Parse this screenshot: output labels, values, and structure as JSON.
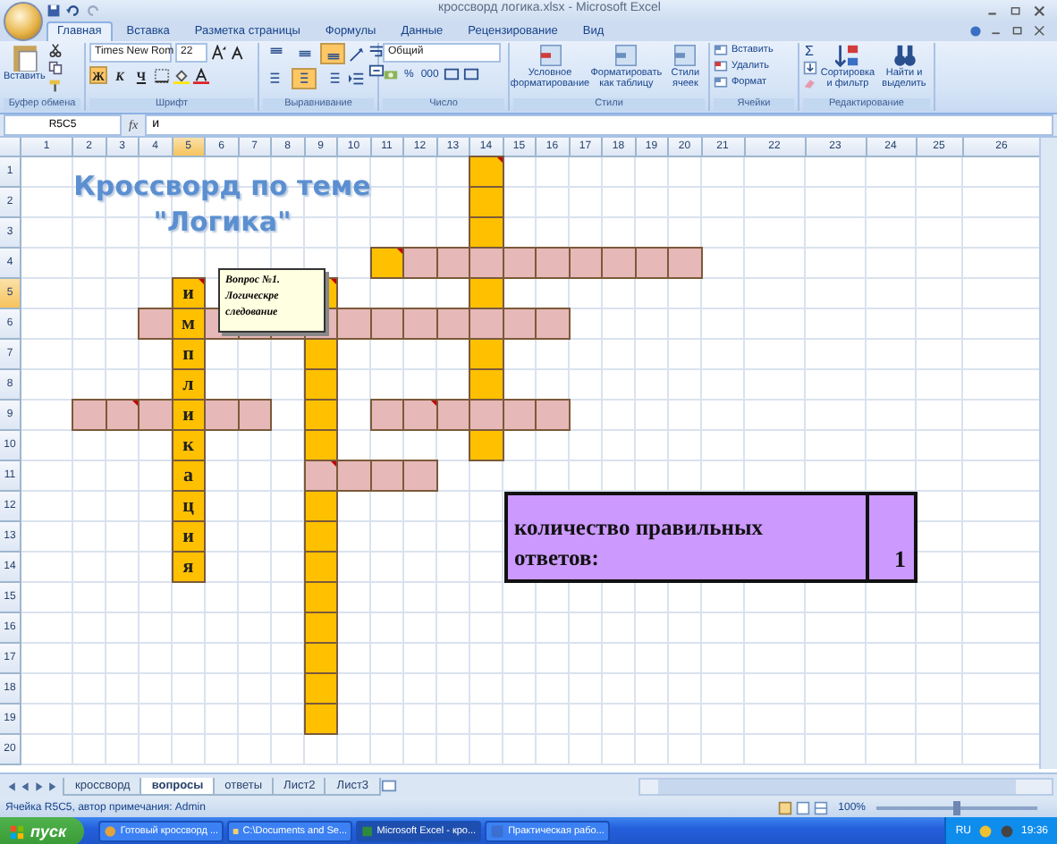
{
  "window": {
    "title": "кроссворд логика.xlsx - Microsoft Excel"
  },
  "ribbon_tabs": [
    {
      "label": "Главная",
      "selected": true
    },
    {
      "label": "Вставка",
      "selected": false
    },
    {
      "label": "Разметка страницы",
      "selected": false
    },
    {
      "label": "Формулы",
      "selected": false
    },
    {
      "label": "Данные",
      "selected": false
    },
    {
      "label": "Рецензирование",
      "selected": false
    },
    {
      "label": "Вид",
      "selected": false
    }
  ],
  "ribbon": {
    "clipboard": {
      "title": "Буфер обмена",
      "paste": "Вставить"
    },
    "font": {
      "title": "Шрифт",
      "font_name": "Times New Rom",
      "font_size": "22",
      "format_buttons": [
        {
          "label": "Ж",
          "on": true
        },
        {
          "label": "К",
          "on": false
        },
        {
          "label": "Ч",
          "on": false
        }
      ]
    },
    "alignment": {
      "title": "Выравнивание",
      "vertical": [
        {
          "on": false
        },
        {
          "on": false
        },
        {
          "on": true
        }
      ],
      "horizontal": [
        {
          "on": false
        },
        {
          "on": true
        },
        {
          "on": false
        }
      ]
    },
    "number": {
      "title": "Число",
      "format": "Общий",
      "symbols": [
        "%",
        "000"
      ]
    },
    "styles": {
      "title": "Стили",
      "buttons": [
        "Условное форматирование",
        "Форматировать как таблицу",
        "Стили ячеек"
      ]
    },
    "cells": {
      "title": "Ячейки",
      "buttons": [
        "Вставить",
        "Удалить",
        "Формат"
      ]
    },
    "editing": {
      "title": "Редактирование",
      "sum": "Σ",
      "buttons": [
        "Сортировка и фильтр",
        "Найти и выделить"
      ]
    }
  },
  "formula_bar": {
    "name_box": "R5C5",
    "function_label": "fx",
    "value": "и"
  },
  "columns": [
    {
      "label": "1",
      "selected": false
    },
    {
      "label": "2",
      "selected": false
    },
    {
      "label": "3",
      "selected": false
    },
    {
      "label": "4",
      "selected": false
    },
    {
      "label": "5",
      "selected": true
    },
    {
      "label": "6",
      "selected": false
    },
    {
      "label": "7",
      "selected": false
    },
    {
      "label": "8",
      "selected": false
    },
    {
      "label": "9",
      "selected": false
    },
    {
      "label": "10",
      "selected": false
    },
    {
      "label": "11",
      "selected": false
    },
    {
      "label": "12",
      "selected": false
    },
    {
      "label": "13",
      "selected": false
    },
    {
      "label": "14",
      "selected": false
    },
    {
      "label": "15",
      "selected": false
    },
    {
      "label": "16",
      "selected": false
    },
    {
      "label": "17",
      "selected": false
    },
    {
      "label": "18",
      "selected": false
    },
    {
      "label": "19",
      "selected": false
    },
    {
      "label": "20",
      "selected": false
    },
    {
      "label": "21",
      "selected": false
    },
    {
      "label": "22",
      "selected": false
    },
    {
      "label": "23",
      "selected": false
    },
    {
      "label": "24",
      "selected": false
    },
    {
      "label": "25",
      "selected": false
    },
    {
      "label": "26",
      "selected": false
    }
  ],
  "rows": [
    {
      "label": "1",
      "selected": false,
      "cells": [
        {
          "kind": "empty"
        },
        {
          "kind": "empty"
        },
        {
          "kind": "empty"
        },
        {
          "kind": "empty"
        },
        {
          "kind": "empty"
        },
        {
          "kind": "empty"
        },
        {
          "kind": "empty"
        },
        {
          "kind": "empty"
        },
        {
          "kind": "empty"
        },
        {
          "kind": "empty"
        },
        {
          "kind": "empty"
        },
        {
          "kind": "empty"
        },
        {
          "kind": "empty"
        },
        {
          "kind": "down",
          "commented": true
        }
      ]
    },
    {
      "label": "2",
      "selected": false,
      "cells": [
        {
          "kind": "empty"
        },
        {
          "kind": "empty"
        },
        {
          "kind": "empty"
        },
        {
          "kind": "empty"
        },
        {
          "kind": "empty"
        },
        {
          "kind": "empty"
        },
        {
          "kind": "empty"
        },
        {
          "kind": "empty"
        },
        {
          "kind": "empty"
        },
        {
          "kind": "empty"
        },
        {
          "kind": "empty"
        },
        {
          "kind": "empty"
        },
        {
          "kind": "empty"
        },
        {
          "kind": "down"
        }
      ]
    },
    {
      "label": "3",
      "selected": false,
      "cells": [
        {
          "kind": "empty"
        },
        {
          "kind": "empty"
        },
        {
          "kind": "empty"
        },
        {
          "kind": "empty"
        },
        {
          "kind": "empty"
        },
        {
          "kind": "empty"
        },
        {
          "kind": "empty"
        },
        {
          "kind": "empty"
        },
        {
          "kind": "empty"
        },
        {
          "kind": "empty"
        },
        {
          "kind": "empty"
        },
        {
          "kind": "empty"
        },
        {
          "kind": "empty"
        },
        {
          "kind": "down"
        }
      ]
    },
    {
      "label": "4",
      "selected": false,
      "cells": [
        {
          "kind": "empty"
        },
        {
          "kind": "empty"
        },
        {
          "kind": "empty"
        },
        {
          "kind": "empty"
        },
        {
          "kind": "empty"
        },
        {
          "kind": "empty"
        },
        {
          "kind": "empty"
        },
        {
          "kind": "empty"
        },
        {
          "kind": "empty"
        },
        {
          "kind": "empty"
        },
        {
          "kind": "down",
          "commented": true
        },
        {
          "kind": "across"
        },
        {
          "kind": "across"
        },
        {
          "kind": "across"
        },
        {
          "kind": "across"
        },
        {
          "kind": "across"
        },
        {
          "kind": "across"
        },
        {
          "kind": "across"
        },
        {
          "kind": "across"
        },
        {
          "kind": "across"
        }
      ]
    },
    {
      "label": "5",
      "selected": true,
      "cells": [
        {
          "kind": "empty"
        },
        {
          "kind": "empty"
        },
        {
          "kind": "empty"
        },
        {
          "kind": "empty"
        },
        {
          "kind": "down",
          "letter": "и",
          "commented": true
        },
        {
          "kind": "empty"
        },
        {
          "kind": "empty"
        },
        {
          "kind": "empty"
        },
        {
          "kind": "down",
          "commented": true
        },
        {
          "kind": "empty"
        },
        {
          "kind": "empty"
        },
        {
          "kind": "empty"
        },
        {
          "kind": "empty"
        },
        {
          "kind": "down"
        }
      ]
    },
    {
      "label": "6",
      "selected": false,
      "cells": [
        {
          "kind": "empty"
        },
        {
          "kind": "empty"
        },
        {
          "kind": "empty"
        },
        {
          "kind": "across"
        },
        {
          "kind": "down",
          "letter": "м"
        },
        {
          "kind": "across"
        },
        {
          "kind": "across"
        },
        {
          "kind": "across"
        },
        {
          "kind": "across"
        },
        {
          "kind": "across"
        },
        {
          "kind": "across"
        },
        {
          "kind": "across"
        },
        {
          "kind": "across"
        },
        {
          "kind": "across"
        },
        {
          "kind": "across"
        },
        {
          "kind": "across"
        }
      ]
    },
    {
      "label": "7",
      "selected": false,
      "cells": [
        {
          "kind": "empty"
        },
        {
          "kind": "empty"
        },
        {
          "kind": "empty"
        },
        {
          "kind": "empty"
        },
        {
          "kind": "down",
          "letter": "п"
        },
        {
          "kind": "empty"
        },
        {
          "kind": "empty"
        },
        {
          "kind": "empty"
        },
        {
          "kind": "down"
        },
        {
          "kind": "empty"
        },
        {
          "kind": "empty"
        },
        {
          "kind": "empty"
        },
        {
          "kind": "empty"
        },
        {
          "kind": "down"
        }
      ]
    },
    {
      "label": "8",
      "selected": false,
      "cells": [
        {
          "kind": "empty"
        },
        {
          "kind": "empty"
        },
        {
          "kind": "empty"
        },
        {
          "kind": "empty"
        },
        {
          "kind": "down",
          "letter": "л"
        },
        {
          "kind": "empty"
        },
        {
          "kind": "empty"
        },
        {
          "kind": "empty"
        },
        {
          "kind": "down"
        },
        {
          "kind": "empty"
        },
        {
          "kind": "empty"
        },
        {
          "kind": "empty"
        },
        {
          "kind": "empty"
        },
        {
          "kind": "down"
        }
      ]
    },
    {
      "label": "9",
      "selected": false,
      "cells": [
        {
          "kind": "empty"
        },
        {
          "kind": "across"
        },
        {
          "kind": "across",
          "commented": true
        },
        {
          "kind": "across"
        },
        {
          "kind": "down",
          "letter": "и"
        },
        {
          "kind": "across"
        },
        {
          "kind": "across"
        },
        {
          "kind": "empty"
        },
        {
          "kind": "down"
        },
        {
          "kind": "empty"
        },
        {
          "kind": "across"
        },
        {
          "kind": "across",
          "commented": true
        },
        {
          "kind": "across"
        },
        {
          "kind": "across"
        },
        {
          "kind": "across"
        },
        {
          "kind": "across"
        }
      ]
    },
    {
      "label": "10",
      "selected": false,
      "cells": [
        {
          "kind": "empty"
        },
        {
          "kind": "empty"
        },
        {
          "kind": "empty"
        },
        {
          "kind": "empty"
        },
        {
          "kind": "down",
          "letter": "к"
        },
        {
          "kind": "empty"
        },
        {
          "kind": "empty"
        },
        {
          "kind": "empty"
        },
        {
          "kind": "down"
        },
        {
          "kind": "empty"
        },
        {
          "kind": "empty"
        },
        {
          "kind": "empty"
        },
        {
          "kind": "empty"
        },
        {
          "kind": "down"
        }
      ]
    },
    {
      "label": "11",
      "selected": false,
      "cells": [
        {
          "kind": "empty"
        },
        {
          "kind": "empty"
        },
        {
          "kind": "empty"
        },
        {
          "kind": "empty"
        },
        {
          "kind": "down",
          "letter": "а"
        },
        {
          "kind": "empty"
        },
        {
          "kind": "empty"
        },
        {
          "kind": "empty"
        },
        {
          "kind": "across",
          "commented": true
        },
        {
          "kind": "across"
        },
        {
          "kind": "across"
        },
        {
          "kind": "across"
        }
      ]
    },
    {
      "label": "12",
      "selected": false,
      "cells": [
        {
          "kind": "empty"
        },
        {
          "kind": "empty"
        },
        {
          "kind": "empty"
        },
        {
          "kind": "empty"
        },
        {
          "kind": "down",
          "letter": "ц"
        },
        {
          "kind": "empty"
        },
        {
          "kind": "empty"
        },
        {
          "kind": "empty"
        },
        {
          "kind": "down"
        }
      ]
    },
    {
      "label": "13",
      "selected": false,
      "cells": [
        {
          "kind": "empty"
        },
        {
          "kind": "empty"
        },
        {
          "kind": "empty"
        },
        {
          "kind": "empty"
        },
        {
          "kind": "down",
          "letter": "и"
        },
        {
          "kind": "empty"
        },
        {
          "kind": "empty"
        },
        {
          "kind": "empty"
        },
        {
          "kind": "down"
        }
      ]
    },
    {
      "label": "14",
      "selected": false,
      "cells": [
        {
          "kind": "empty"
        },
        {
          "kind": "empty"
        },
        {
          "kind": "empty"
        },
        {
          "kind": "empty"
        },
        {
          "kind": "down",
          "letter": "я"
        },
        {
          "kind": "empty"
        },
        {
          "kind": "empty"
        },
        {
          "kind": "empty"
        },
        {
          "kind": "down"
        }
      ]
    },
    {
      "label": "15",
      "selected": false,
      "cells": [
        {
          "kind": "empty"
        },
        {
          "kind": "empty"
        },
        {
          "kind": "empty"
        },
        {
          "kind": "empty"
        },
        {
          "kind": "empty"
        },
        {
          "kind": "empty"
        },
        {
          "kind": "empty"
        },
        {
          "kind": "empty"
        },
        {
          "kind": "down"
        }
      ]
    },
    {
      "label": "16",
      "selected": false,
      "cells": [
        {
          "kind": "empty"
        },
        {
          "kind": "empty"
        },
        {
          "kind": "empty"
        },
        {
          "kind": "empty"
        },
        {
          "kind": "empty"
        },
        {
          "kind": "empty"
        },
        {
          "kind": "empty"
        },
        {
          "kind": "empty"
        },
        {
          "kind": "down"
        }
      ]
    },
    {
      "label": "17",
      "selected": false,
      "cells": [
        {
          "kind": "empty"
        },
        {
          "kind": "empty"
        },
        {
          "kind": "empty"
        },
        {
          "kind": "empty"
        },
        {
          "kind": "empty"
        },
        {
          "kind": "empty"
        },
        {
          "kind": "empty"
        },
        {
          "kind": "empty"
        },
        {
          "kind": "down"
        }
      ]
    },
    {
      "label": "18",
      "selected": false,
      "cells": [
        {
          "kind": "empty"
        },
        {
          "kind": "empty"
        },
        {
          "kind": "empty"
        },
        {
          "kind": "empty"
        },
        {
          "kind": "empty"
        },
        {
          "kind": "empty"
        },
        {
          "kind": "empty"
        },
        {
          "kind": "empty"
        },
        {
          "kind": "down"
        }
      ]
    },
    {
      "label": "19",
      "selected": false,
      "cells": [
        {
          "kind": "empty"
        },
        {
          "kind": "empty"
        },
        {
          "kind": "empty"
        },
        {
          "kind": "empty"
        },
        {
          "kind": "empty"
        },
        {
          "kind": "empty"
        },
        {
          "kind": "empty"
        },
        {
          "kind": "empty"
        },
        {
          "kind": "down"
        }
      ]
    },
    {
      "label": "20",
      "selected": false,
      "cells": []
    }
  ],
  "sheet_title": [
    "Кроссворд по теме",
    "\"Логика\""
  ],
  "comment": {
    "text": "Вопрос №1. Логическре следование"
  },
  "result": {
    "label": "количество правильных ответов:",
    "value": "1"
  },
  "sheet_tabs": [
    {
      "label": "кроссворд",
      "selected": false
    },
    {
      "label": "вопросы",
      "selected": true
    },
    {
      "label": "ответы",
      "selected": false
    },
    {
      "label": "Лист2",
      "selected": false
    },
    {
      "label": "Лист3",
      "selected": false
    }
  ],
  "status_bar": {
    "text": "Ячейка R5C5, автор примечания: Admin",
    "zoom": "100%",
    "zoom_slider": {
      "level": 0.5
    }
  },
  "taskbar": {
    "start": "пуск",
    "tasks": [
      {
        "label": "Готовый кроссворд ...",
        "selected": false
      },
      {
        "label": "C:\\Documents and Se...",
        "selected": false
      },
      {
        "label": "Microsoft Excel - кро...",
        "selected": true
      },
      {
        "label": "Практическая рабо...",
        "selected": false
      }
    ],
    "language": "RU",
    "clock": "19:36"
  }
}
